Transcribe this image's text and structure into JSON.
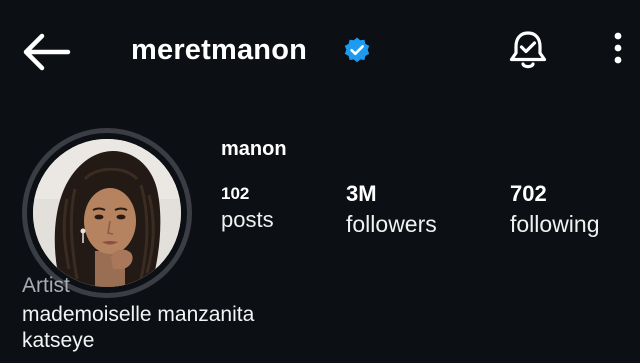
{
  "header": {
    "username": "meretmanon",
    "back_icon": "arrow-left-icon",
    "verified_icon": "verified-badge-icon",
    "bell_icon": "bell-notification-icon",
    "more_icon": "more-vertical-icon"
  },
  "profile": {
    "display_name": "manon",
    "avatar_icon": "profile-photo",
    "stats": {
      "posts": {
        "count": "102",
        "label": "posts"
      },
      "followers": {
        "count": "3M",
        "label": "followers"
      },
      "following": {
        "count": "702",
        "label": "following"
      }
    },
    "category": "Artist",
    "bio": [
      "mademoiselle manzanita",
      "katseye"
    ]
  },
  "colors": {
    "background": "#0c0f14",
    "text_primary": "#ffffff",
    "text_secondary": "#a8acb3",
    "verified_blue": "#1d9bf0",
    "avatar_ring": "#3a3e44"
  }
}
